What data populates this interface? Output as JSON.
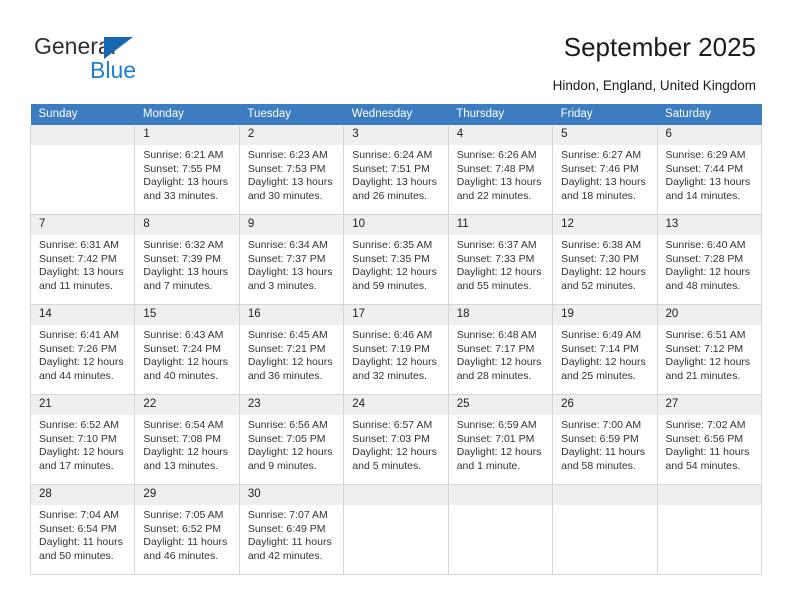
{
  "brand": {
    "name_part1": "General",
    "name_part2": "Blue",
    "accent_color": "#1f7fd0",
    "triangle_color": "#1567b2"
  },
  "header": {
    "title": "September 2025",
    "location": "Hindon, England, United Kingdom"
  },
  "calendar": {
    "header_bg": "#3b7dc0",
    "daynum_bg": "#efefef",
    "weekday_names": [
      "Sunday",
      "Monday",
      "Tuesday",
      "Wednesday",
      "Thursday",
      "Friday",
      "Saturday"
    ],
    "weeks": [
      [
        {
          "day": "",
          "sunrise": "",
          "sunset": "",
          "daylight1": "",
          "daylight2": ""
        },
        {
          "day": "1",
          "sunrise": "Sunrise: 6:21 AM",
          "sunset": "Sunset: 7:55 PM",
          "daylight1": "Daylight: 13 hours",
          "daylight2": "and 33 minutes."
        },
        {
          "day": "2",
          "sunrise": "Sunrise: 6:23 AM",
          "sunset": "Sunset: 7:53 PM",
          "daylight1": "Daylight: 13 hours",
          "daylight2": "and 30 minutes."
        },
        {
          "day": "3",
          "sunrise": "Sunrise: 6:24 AM",
          "sunset": "Sunset: 7:51 PM",
          "daylight1": "Daylight: 13 hours",
          "daylight2": "and 26 minutes."
        },
        {
          "day": "4",
          "sunrise": "Sunrise: 6:26 AM",
          "sunset": "Sunset: 7:48 PM",
          "daylight1": "Daylight: 13 hours",
          "daylight2": "and 22 minutes."
        },
        {
          "day": "5",
          "sunrise": "Sunrise: 6:27 AM",
          "sunset": "Sunset: 7:46 PM",
          "daylight1": "Daylight: 13 hours",
          "daylight2": "and 18 minutes."
        },
        {
          "day": "6",
          "sunrise": "Sunrise: 6:29 AM",
          "sunset": "Sunset: 7:44 PM",
          "daylight1": "Daylight: 13 hours",
          "daylight2": "and 14 minutes."
        }
      ],
      [
        {
          "day": "7",
          "sunrise": "Sunrise: 6:31 AM",
          "sunset": "Sunset: 7:42 PM",
          "daylight1": "Daylight: 13 hours",
          "daylight2": "and 11 minutes."
        },
        {
          "day": "8",
          "sunrise": "Sunrise: 6:32 AM",
          "sunset": "Sunset: 7:39 PM",
          "daylight1": "Daylight: 13 hours",
          "daylight2": "and 7 minutes."
        },
        {
          "day": "9",
          "sunrise": "Sunrise: 6:34 AM",
          "sunset": "Sunset: 7:37 PM",
          "daylight1": "Daylight: 13 hours",
          "daylight2": "and 3 minutes."
        },
        {
          "day": "10",
          "sunrise": "Sunrise: 6:35 AM",
          "sunset": "Sunset: 7:35 PM",
          "daylight1": "Daylight: 12 hours",
          "daylight2": "and 59 minutes."
        },
        {
          "day": "11",
          "sunrise": "Sunrise: 6:37 AM",
          "sunset": "Sunset: 7:33 PM",
          "daylight1": "Daylight: 12 hours",
          "daylight2": "and 55 minutes."
        },
        {
          "day": "12",
          "sunrise": "Sunrise: 6:38 AM",
          "sunset": "Sunset: 7:30 PM",
          "daylight1": "Daylight: 12 hours",
          "daylight2": "and 52 minutes."
        },
        {
          "day": "13",
          "sunrise": "Sunrise: 6:40 AM",
          "sunset": "Sunset: 7:28 PM",
          "daylight1": "Daylight: 12 hours",
          "daylight2": "and 48 minutes."
        }
      ],
      [
        {
          "day": "14",
          "sunrise": "Sunrise: 6:41 AM",
          "sunset": "Sunset: 7:26 PM",
          "daylight1": "Daylight: 12 hours",
          "daylight2": "and 44 minutes."
        },
        {
          "day": "15",
          "sunrise": "Sunrise: 6:43 AM",
          "sunset": "Sunset: 7:24 PM",
          "daylight1": "Daylight: 12 hours",
          "daylight2": "and 40 minutes."
        },
        {
          "day": "16",
          "sunrise": "Sunrise: 6:45 AM",
          "sunset": "Sunset: 7:21 PM",
          "daylight1": "Daylight: 12 hours",
          "daylight2": "and 36 minutes."
        },
        {
          "day": "17",
          "sunrise": "Sunrise: 6:46 AM",
          "sunset": "Sunset: 7:19 PM",
          "daylight1": "Daylight: 12 hours",
          "daylight2": "and 32 minutes."
        },
        {
          "day": "18",
          "sunrise": "Sunrise: 6:48 AM",
          "sunset": "Sunset: 7:17 PM",
          "daylight1": "Daylight: 12 hours",
          "daylight2": "and 28 minutes."
        },
        {
          "day": "19",
          "sunrise": "Sunrise: 6:49 AM",
          "sunset": "Sunset: 7:14 PM",
          "daylight1": "Daylight: 12 hours",
          "daylight2": "and 25 minutes."
        },
        {
          "day": "20",
          "sunrise": "Sunrise: 6:51 AM",
          "sunset": "Sunset: 7:12 PM",
          "daylight1": "Daylight: 12 hours",
          "daylight2": "and 21 minutes."
        }
      ],
      [
        {
          "day": "21",
          "sunrise": "Sunrise: 6:52 AM",
          "sunset": "Sunset: 7:10 PM",
          "daylight1": "Daylight: 12 hours",
          "daylight2": "and 17 minutes."
        },
        {
          "day": "22",
          "sunrise": "Sunrise: 6:54 AM",
          "sunset": "Sunset: 7:08 PM",
          "daylight1": "Daylight: 12 hours",
          "daylight2": "and 13 minutes."
        },
        {
          "day": "23",
          "sunrise": "Sunrise: 6:56 AM",
          "sunset": "Sunset: 7:05 PM",
          "daylight1": "Daylight: 12 hours",
          "daylight2": "and 9 minutes."
        },
        {
          "day": "24",
          "sunrise": "Sunrise: 6:57 AM",
          "sunset": "Sunset: 7:03 PM",
          "daylight1": "Daylight: 12 hours",
          "daylight2": "and 5 minutes."
        },
        {
          "day": "25",
          "sunrise": "Sunrise: 6:59 AM",
          "sunset": "Sunset: 7:01 PM",
          "daylight1": "Daylight: 12 hours",
          "daylight2": "and 1 minute."
        },
        {
          "day": "26",
          "sunrise": "Sunrise: 7:00 AM",
          "sunset": "Sunset: 6:59 PM",
          "daylight1": "Daylight: 11 hours",
          "daylight2": "and 58 minutes."
        },
        {
          "day": "27",
          "sunrise": "Sunrise: 7:02 AM",
          "sunset": "Sunset: 6:56 PM",
          "daylight1": "Daylight: 11 hours",
          "daylight2": "and 54 minutes."
        }
      ],
      [
        {
          "day": "28",
          "sunrise": "Sunrise: 7:04 AM",
          "sunset": "Sunset: 6:54 PM",
          "daylight1": "Daylight: 11 hours",
          "daylight2": "and 50 minutes."
        },
        {
          "day": "29",
          "sunrise": "Sunrise: 7:05 AM",
          "sunset": "Sunset: 6:52 PM",
          "daylight1": "Daylight: 11 hours",
          "daylight2": "and 46 minutes."
        },
        {
          "day": "30",
          "sunrise": "Sunrise: 7:07 AM",
          "sunset": "Sunset: 6:49 PM",
          "daylight1": "Daylight: 11 hours",
          "daylight2": "and 42 minutes."
        },
        {
          "day": "",
          "sunrise": "",
          "sunset": "",
          "daylight1": "",
          "daylight2": ""
        },
        {
          "day": "",
          "sunrise": "",
          "sunset": "",
          "daylight1": "",
          "daylight2": ""
        },
        {
          "day": "",
          "sunrise": "",
          "sunset": "",
          "daylight1": "",
          "daylight2": ""
        },
        {
          "day": "",
          "sunrise": "",
          "sunset": "",
          "daylight1": "",
          "daylight2": ""
        }
      ]
    ]
  }
}
